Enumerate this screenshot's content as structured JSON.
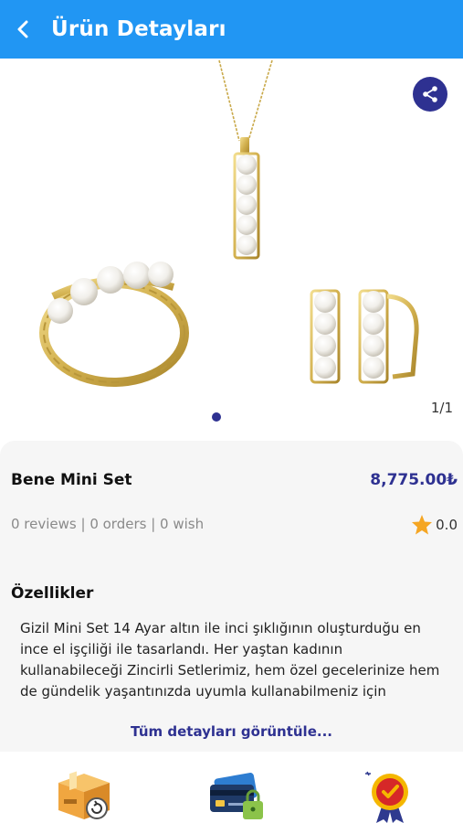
{
  "appbar": {
    "title": "Ürün Detayları",
    "color": "#2196f3"
  },
  "gallery": {
    "counter": "1/1",
    "accent": "#2e3191"
  },
  "product": {
    "name": "Bene Mini Set",
    "price": "8,775.00₺",
    "stats": "0 reviews | 0 orders | 0 wish",
    "rating": "0.0"
  },
  "features": {
    "title": "Özellikler",
    "description": "Gizil Mini Set 14 Ayar altın ile inci şıklığının oluşturduğu en ince el işçiliği ile tasarlandı. Her yaştan kadının kullanabileceği Zincirli Setlerimiz, hem özel gecelerinize hem de gündelik yaşantınızda uyumla kullanabilmeniz için tasarlanmıştır. Eşsiz bir hediye olan Zincirli Setimiz",
    "more_label": "Tüm detayları görüntüle..."
  },
  "bottom_icons": [
    "shipping-box-return-icon",
    "credit-card-secure-icon",
    "quality-badge-icon"
  ]
}
